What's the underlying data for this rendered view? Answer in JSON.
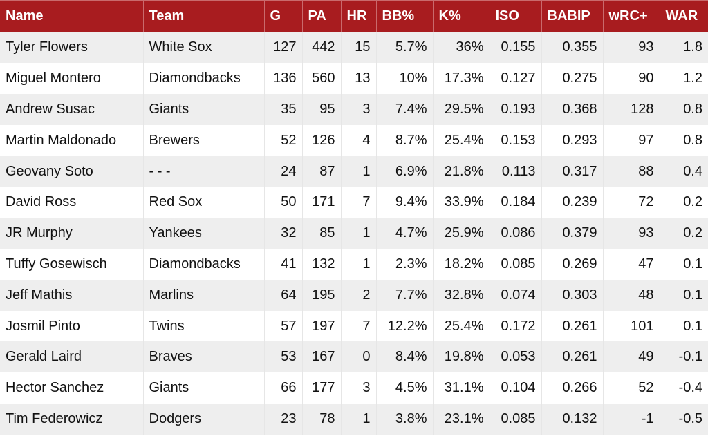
{
  "table": {
    "headers": [
      "Name",
      "Team",
      "G",
      "PA",
      "HR",
      "BB%",
      "K%",
      "ISO",
      "BABIP",
      "wRC+",
      "WAR"
    ],
    "rows": [
      [
        "Tyler Flowers",
        "White Sox",
        "127",
        "442",
        "15",
        "5.7%",
        "36%",
        "0.155",
        "0.355",
        "93",
        "1.8"
      ],
      [
        "Miguel Montero",
        "Diamondbacks",
        "136",
        "560",
        "13",
        "10%",
        "17.3%",
        "0.127",
        "0.275",
        "90",
        "1.2"
      ],
      [
        "Andrew Susac",
        "Giants",
        "35",
        "95",
        "3",
        "7.4%",
        "29.5%",
        "0.193",
        "0.368",
        "128",
        "0.8"
      ],
      [
        "Martin Maldonado",
        "Brewers",
        "52",
        "126",
        "4",
        "8.7%",
        "25.4%",
        "0.153",
        "0.293",
        "97",
        "0.8"
      ],
      [
        "Geovany Soto",
        "- - -",
        "24",
        "87",
        "1",
        "6.9%",
        "21.8%",
        "0.113",
        "0.317",
        "88",
        "0.4"
      ],
      [
        "David Ross",
        "Red Sox",
        "50",
        "171",
        "7",
        "9.4%",
        "33.9%",
        "0.184",
        "0.239",
        "72",
        "0.2"
      ],
      [
        "JR Murphy",
        "Yankees",
        "32",
        "85",
        "1",
        "4.7%",
        "25.9%",
        "0.086",
        "0.379",
        "93",
        "0.2"
      ],
      [
        "Tuffy Gosewisch",
        "Diamondbacks",
        "41",
        "132",
        "1",
        "2.3%",
        "18.2%",
        "0.085",
        "0.269",
        "47",
        "0.1"
      ],
      [
        "Jeff Mathis",
        "Marlins",
        "64",
        "195",
        "2",
        "7.7%",
        "32.8%",
        "0.074",
        "0.303",
        "48",
        "0.1"
      ],
      [
        "Josmil Pinto",
        "Twins",
        "57",
        "197",
        "7",
        "12.2%",
        "25.4%",
        "0.172",
        "0.261",
        "101",
        "0.1"
      ],
      [
        "Gerald Laird",
        "Braves",
        "53",
        "167",
        "0",
        "8.4%",
        "19.8%",
        "0.053",
        "0.261",
        "49",
        "-0.1"
      ],
      [
        "Hector Sanchez",
        "Giants",
        "66",
        "177",
        "3",
        "4.5%",
        "31.1%",
        "0.104",
        "0.266",
        "52",
        "-0.4"
      ],
      [
        "Tim Federowicz",
        "Dodgers",
        "23",
        "78",
        "1",
        "3.8%",
        "23.1%",
        "0.085",
        "0.132",
        "-1",
        "-0.5"
      ]
    ]
  },
  "colors": {
    "header_bg": "#a81c1f",
    "header_text": "#ffffff",
    "row_alt": "#eeeeee"
  }
}
